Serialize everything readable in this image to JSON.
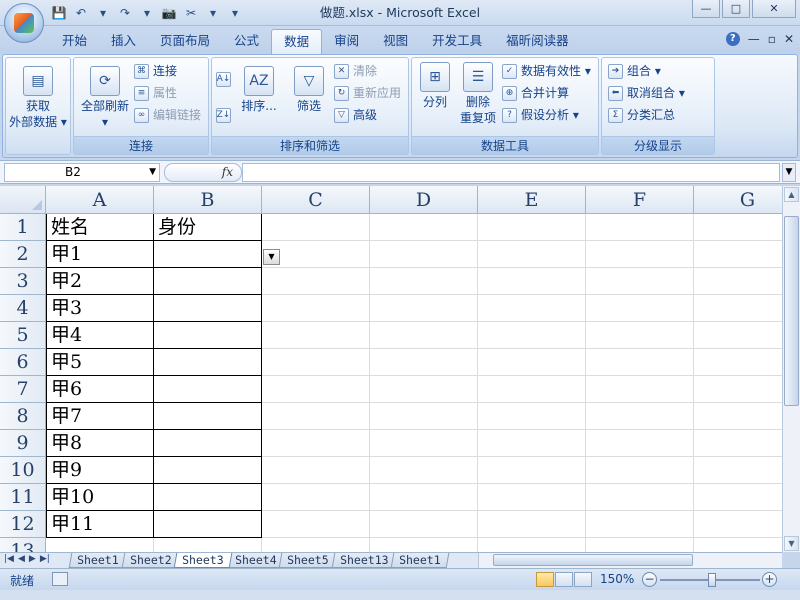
{
  "window": {
    "title": "做题.xlsx - Microsoft Excel",
    "minimize": "—",
    "restore": "□",
    "close": "✕"
  },
  "qat": [
    "💾",
    "↶",
    "▾",
    "↷",
    "▾",
    "📷",
    "✂",
    "▾",
    "▾"
  ],
  "tabs": [
    "开始",
    "插入",
    "页面布局",
    "公式",
    "数据",
    "审阅",
    "视图",
    "开发工具",
    "福昕阅读器"
  ],
  "active_tab": "数据",
  "tabbar_right": {
    "help": "?",
    "min": "—",
    "restore": "▫",
    "close": "✕"
  },
  "ribbon": {
    "group1": {
      "btn_line1": "获取",
      "btn_line2": "外部数据 ▾"
    },
    "group2": {
      "caption": "连接",
      "refresh_line1": "全部刷新",
      "refresh_line2": "▾",
      "connections": "连接",
      "properties": "属性",
      "edit_links": "编辑链接"
    },
    "group3": {
      "caption": "排序和筛选",
      "sort": "排序...",
      "filter": "筛选",
      "clear": "清除",
      "reapply": "重新应用",
      "advanced": "高级"
    },
    "group4": {
      "caption": "数据工具",
      "text_to_columns": "分列",
      "remove_dup_line1": "删除",
      "remove_dup_line2": "重复项",
      "validation": "数据有效性 ▾",
      "consolidate": "合并计算",
      "whatif": "假设分析 ▾"
    },
    "group5": {
      "caption": "分级显示",
      "group": "组合 ▾",
      "ungroup": "取消组合 ▾",
      "subtotal": "分类汇总"
    }
  },
  "formula_bar": {
    "name_box": "B2",
    "fx": "fx",
    "formula": ""
  },
  "columns": [
    "A",
    "B",
    "C",
    "D",
    "E",
    "F",
    "G"
  ],
  "rows": [
    {
      "num": "1",
      "a": "姓名",
      "b": "身份"
    },
    {
      "num": "2",
      "a": "甲1",
      "b": ""
    },
    {
      "num": "3",
      "a": "甲2",
      "b": ""
    },
    {
      "num": "4",
      "a": "甲3",
      "b": ""
    },
    {
      "num": "5",
      "a": "甲4",
      "b": ""
    },
    {
      "num": "6",
      "a": "甲5",
      "b": ""
    },
    {
      "num": "7",
      "a": "甲6",
      "b": ""
    },
    {
      "num": "8",
      "a": "甲7",
      "b": ""
    },
    {
      "num": "9",
      "a": "甲8",
      "b": ""
    },
    {
      "num": "10",
      "a": "甲9",
      "b": ""
    },
    {
      "num": "11",
      "a": "甲10",
      "b": ""
    },
    {
      "num": "12",
      "a": "甲11",
      "b": ""
    },
    {
      "num": "13",
      "a": "",
      "b": ""
    }
  ],
  "sheets": [
    "Sheet1",
    "Sheet2",
    "Sheet3",
    "Sheet4",
    "Sheet5",
    "Sheet13",
    "Sheet1"
  ],
  "active_sheet": "Sheet3",
  "status": {
    "ready": "就绪",
    "zoom": "150%",
    "zoom_minus": "−",
    "zoom_plus": "+"
  }
}
